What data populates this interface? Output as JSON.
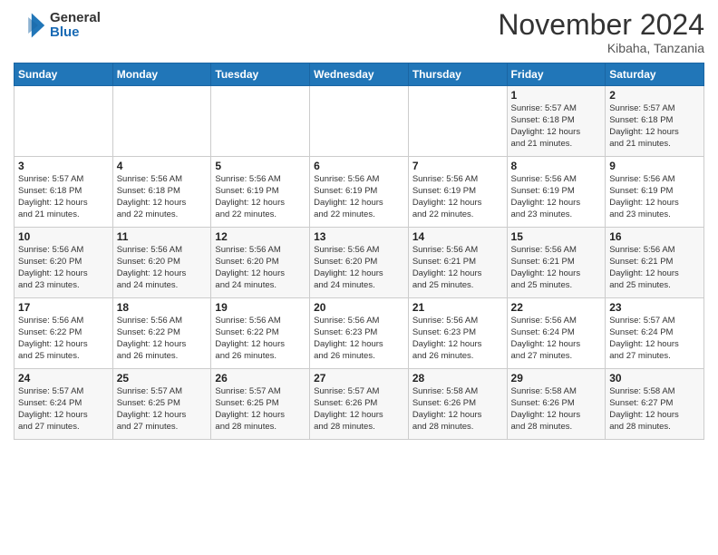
{
  "header": {
    "logo_general": "General",
    "logo_blue": "Blue",
    "month_title": "November 2024",
    "location": "Kibaha, Tanzania"
  },
  "days_of_week": [
    "Sunday",
    "Monday",
    "Tuesday",
    "Wednesday",
    "Thursday",
    "Friday",
    "Saturday"
  ],
  "weeks": [
    [
      {
        "day": "",
        "info": ""
      },
      {
        "day": "",
        "info": ""
      },
      {
        "day": "",
        "info": ""
      },
      {
        "day": "",
        "info": ""
      },
      {
        "day": "",
        "info": ""
      },
      {
        "day": "1",
        "info": "Sunrise: 5:57 AM\nSunset: 6:18 PM\nDaylight: 12 hours\nand 21 minutes."
      },
      {
        "day": "2",
        "info": "Sunrise: 5:57 AM\nSunset: 6:18 PM\nDaylight: 12 hours\nand 21 minutes."
      }
    ],
    [
      {
        "day": "3",
        "info": "Sunrise: 5:57 AM\nSunset: 6:18 PM\nDaylight: 12 hours\nand 21 minutes."
      },
      {
        "day": "4",
        "info": "Sunrise: 5:56 AM\nSunset: 6:18 PM\nDaylight: 12 hours\nand 22 minutes."
      },
      {
        "day": "5",
        "info": "Sunrise: 5:56 AM\nSunset: 6:19 PM\nDaylight: 12 hours\nand 22 minutes."
      },
      {
        "day": "6",
        "info": "Sunrise: 5:56 AM\nSunset: 6:19 PM\nDaylight: 12 hours\nand 22 minutes."
      },
      {
        "day": "7",
        "info": "Sunrise: 5:56 AM\nSunset: 6:19 PM\nDaylight: 12 hours\nand 22 minutes."
      },
      {
        "day": "8",
        "info": "Sunrise: 5:56 AM\nSunset: 6:19 PM\nDaylight: 12 hours\nand 23 minutes."
      },
      {
        "day": "9",
        "info": "Sunrise: 5:56 AM\nSunset: 6:19 PM\nDaylight: 12 hours\nand 23 minutes."
      }
    ],
    [
      {
        "day": "10",
        "info": "Sunrise: 5:56 AM\nSunset: 6:20 PM\nDaylight: 12 hours\nand 23 minutes."
      },
      {
        "day": "11",
        "info": "Sunrise: 5:56 AM\nSunset: 6:20 PM\nDaylight: 12 hours\nand 24 minutes."
      },
      {
        "day": "12",
        "info": "Sunrise: 5:56 AM\nSunset: 6:20 PM\nDaylight: 12 hours\nand 24 minutes."
      },
      {
        "day": "13",
        "info": "Sunrise: 5:56 AM\nSunset: 6:20 PM\nDaylight: 12 hours\nand 24 minutes."
      },
      {
        "day": "14",
        "info": "Sunrise: 5:56 AM\nSunset: 6:21 PM\nDaylight: 12 hours\nand 25 minutes."
      },
      {
        "day": "15",
        "info": "Sunrise: 5:56 AM\nSunset: 6:21 PM\nDaylight: 12 hours\nand 25 minutes."
      },
      {
        "day": "16",
        "info": "Sunrise: 5:56 AM\nSunset: 6:21 PM\nDaylight: 12 hours\nand 25 minutes."
      }
    ],
    [
      {
        "day": "17",
        "info": "Sunrise: 5:56 AM\nSunset: 6:22 PM\nDaylight: 12 hours\nand 25 minutes."
      },
      {
        "day": "18",
        "info": "Sunrise: 5:56 AM\nSunset: 6:22 PM\nDaylight: 12 hours\nand 26 minutes."
      },
      {
        "day": "19",
        "info": "Sunrise: 5:56 AM\nSunset: 6:22 PM\nDaylight: 12 hours\nand 26 minutes."
      },
      {
        "day": "20",
        "info": "Sunrise: 5:56 AM\nSunset: 6:23 PM\nDaylight: 12 hours\nand 26 minutes."
      },
      {
        "day": "21",
        "info": "Sunrise: 5:56 AM\nSunset: 6:23 PM\nDaylight: 12 hours\nand 26 minutes."
      },
      {
        "day": "22",
        "info": "Sunrise: 5:56 AM\nSunset: 6:24 PM\nDaylight: 12 hours\nand 27 minutes."
      },
      {
        "day": "23",
        "info": "Sunrise: 5:57 AM\nSunset: 6:24 PM\nDaylight: 12 hours\nand 27 minutes."
      }
    ],
    [
      {
        "day": "24",
        "info": "Sunrise: 5:57 AM\nSunset: 6:24 PM\nDaylight: 12 hours\nand 27 minutes."
      },
      {
        "day": "25",
        "info": "Sunrise: 5:57 AM\nSunset: 6:25 PM\nDaylight: 12 hours\nand 27 minutes."
      },
      {
        "day": "26",
        "info": "Sunrise: 5:57 AM\nSunset: 6:25 PM\nDaylight: 12 hours\nand 28 minutes."
      },
      {
        "day": "27",
        "info": "Sunrise: 5:57 AM\nSunset: 6:26 PM\nDaylight: 12 hours\nand 28 minutes."
      },
      {
        "day": "28",
        "info": "Sunrise: 5:58 AM\nSunset: 6:26 PM\nDaylight: 12 hours\nand 28 minutes."
      },
      {
        "day": "29",
        "info": "Sunrise: 5:58 AM\nSunset: 6:26 PM\nDaylight: 12 hours\nand 28 minutes."
      },
      {
        "day": "30",
        "info": "Sunrise: 5:58 AM\nSunset: 6:27 PM\nDaylight: 12 hours\nand 28 minutes."
      }
    ]
  ]
}
